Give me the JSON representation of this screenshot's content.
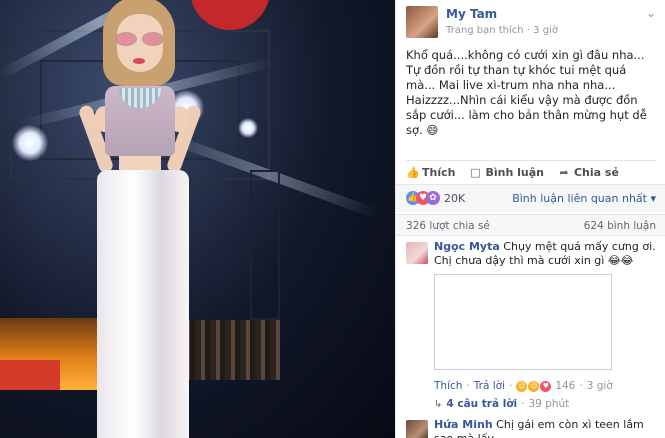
{
  "post": {
    "author": "My Tam",
    "meta_source": "Trang bạn thích",
    "meta_sep": "·",
    "meta_time": "3 giờ",
    "more_icon": "chevron-down-icon",
    "text_lines": [
      "Khổ quá....không có cưới xin gì đâu nha... Tự đồn rồi tự than tự khóc tui mệt quá mà... Mai live xì-trum nha nha nha...",
      "Haizzzz...Nhìn cái kiểu vậy mà được đồn sắp cưới... làm cho bản thân mừng hụt dễ sợ. 😄"
    ]
  },
  "actions": {
    "like": "Thích",
    "comment": "Bình luận",
    "share": "Chia sẻ"
  },
  "reactions": {
    "count": "20K",
    "related_comments": "Bình luận liên quan nhất ▾"
  },
  "stats": {
    "shares": "326 lượt chia sẻ",
    "comments": "624 bình luận"
  },
  "comments": [
    {
      "name": "Ngọc Myta",
      "text": "Chụy mệt quá mấy cưng ơi. Chị chưa dậy thì mà cưới xin gì 😂😂",
      "like": "Thích",
      "reply": "Trả lời",
      "reaction_count": "146",
      "time": "3 giờ"
    },
    {
      "name": "Hứa Minh",
      "text": "Chị gái em còn xì teen lắm sao mà lấy"
    }
  ],
  "replies": {
    "label": "4 câu trả lời",
    "time": "39 phút"
  },
  "colors": {
    "link": "#365899",
    "like_reaction": "#5890ff",
    "love_reaction": "#f25268",
    "haha_reaction": "#f7b125"
  }
}
